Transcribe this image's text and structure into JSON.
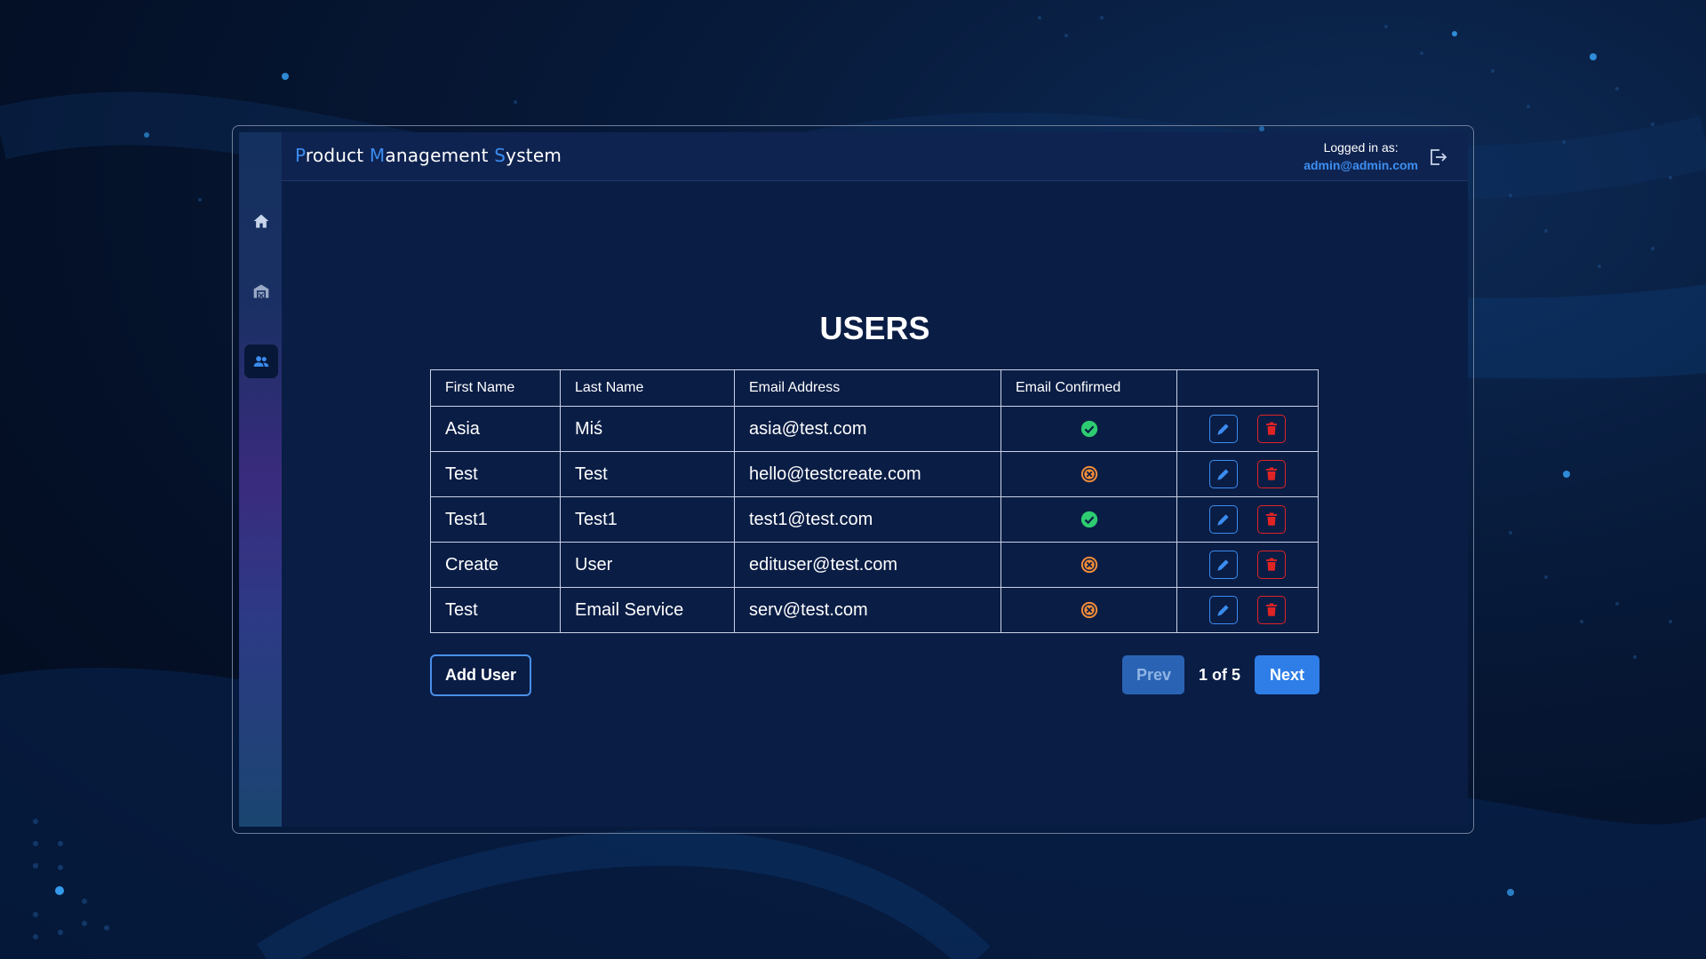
{
  "header": {
    "brand": [
      {
        "initial": "P",
        "rest": "roduct "
      },
      {
        "initial": "M",
        "rest": "anagement "
      },
      {
        "initial": "S",
        "rest": "ystem"
      }
    ],
    "logged_in_label": "Logged in as:",
    "user_email": "admin@admin.com",
    "logout_icon": "logout-icon"
  },
  "sidebar": {
    "items": [
      {
        "icon": "home-icon",
        "active": false
      },
      {
        "icon": "warehouse-icon",
        "active": false
      },
      {
        "icon": "users-icon",
        "active": true
      }
    ]
  },
  "page": {
    "title": "USERS"
  },
  "table": {
    "columns": [
      "First Name",
      "Last Name",
      "Email Address",
      "Email Confirmed",
      ""
    ],
    "rows": [
      {
        "first": "Asia",
        "last": "Miś",
        "email": "asia@test.com",
        "confirmed": true
      },
      {
        "first": "Test",
        "last": "Test",
        "email": "hello@testcreate.com",
        "confirmed": false
      },
      {
        "first": "Test1",
        "last": "Test1",
        "email": "test1@test.com",
        "confirmed": true
      },
      {
        "first": "Create",
        "last": "User",
        "email": "edituser@test.com",
        "confirmed": false
      },
      {
        "first": "Test",
        "last": "Email Service",
        "email": "serv@test.com",
        "confirmed": false
      }
    ]
  },
  "actions": {
    "add_user": "Add User"
  },
  "pagination": {
    "prev": "Prev",
    "next": "Next",
    "current": "1 of 5"
  },
  "colors": {
    "accent": "#3b8cf0",
    "confirmed": "#2ecc71",
    "unconfirmed": "#f28c38",
    "delete": "#e02424"
  }
}
